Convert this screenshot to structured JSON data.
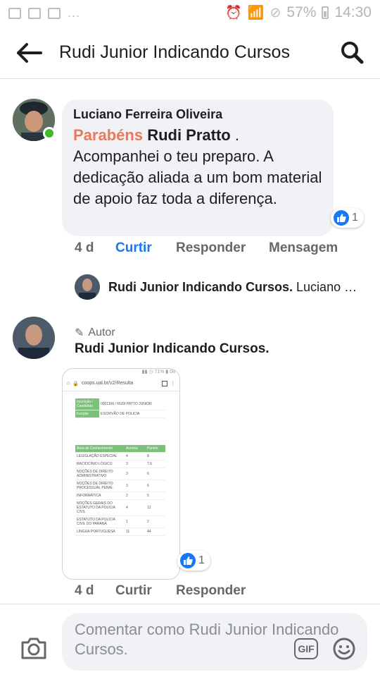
{
  "status_bar": {
    "battery": "57%",
    "time": "14:30",
    "icons": [
      "image-icon",
      "gallery-icon",
      "facebook-icon",
      "more-icon",
      "alarm-icon",
      "wifi-icon",
      "dnd-icon",
      "battery-icon"
    ]
  },
  "header": {
    "title": "Rudi Junior Indicando Cursos",
    "back_icon": "arrow-left-icon",
    "search_icon": "search-icon"
  },
  "comment": {
    "author": "Luciano Ferreira Oliveira",
    "highlight": "Parabéns",
    "mention": "Rudi Pratto",
    "text": ". Acompanhei o teu preparo. A dedicação aliada a um bom material de apoio faz toda a diferença.",
    "reaction_count": "1",
    "time": "4 d",
    "like_label": "Curtir",
    "reply_label": "Responder",
    "message_label": "Mensagem"
  },
  "reply_preview": {
    "author": "Rudi Junior Indicando Cursos.",
    "snippet": "Luciano Ferreira Oliveira"
  },
  "author_reply": {
    "badge": "Autor",
    "author": "Rudi Junior Indicando Cursos.",
    "reaction_count": "1",
    "time": "4 d",
    "like_label": "Curtir",
    "reply_label": "Responder",
    "screenshot": {
      "url": "coops.ual.br/v2/Resulta",
      "rows_top": [
        [
          "Inscrição / Candidato",
          "0001166 / RUDI PATTO JUNIOR"
        ],
        [
          "Função",
          "ESCRIVÃO DE POLÍCIA"
        ]
      ],
      "table_header": [
        "Área de Conhecimento",
        "Acertos",
        "Pontos"
      ],
      "table_rows": [
        [
          "LEGISLAÇÃO ESPECIAL",
          "4",
          "8"
        ],
        [
          "RACIOCÍNIO LÓGICO",
          "3",
          "7,5"
        ],
        [
          "NOÇÕES DE DIREITO ADMINISTRATIVO",
          "3",
          "6"
        ],
        [
          "NOÇÕES DE DIREITO PROCESSUAL PENAL",
          "3",
          "6"
        ],
        [
          "INFORMÁTICA",
          "2",
          "5"
        ],
        [
          "NOÇÕES GERAIS DO ESTATUTO DA POLÍCIA CIVIL",
          "4",
          "12"
        ],
        [
          "ESTATUTO DA POLÍCIA CIVIL DO PARANÁ",
          "1",
          "2"
        ],
        [
          "LÍNGUA PORTUGUESA",
          "11",
          "44"
        ]
      ]
    }
  },
  "composer": {
    "placeholder": "Comentar como Rudi Junior Indicando Cursos.",
    "gif_label": "GIF",
    "camera_icon": "camera-icon",
    "emoji_icon": "emoji-icon"
  }
}
